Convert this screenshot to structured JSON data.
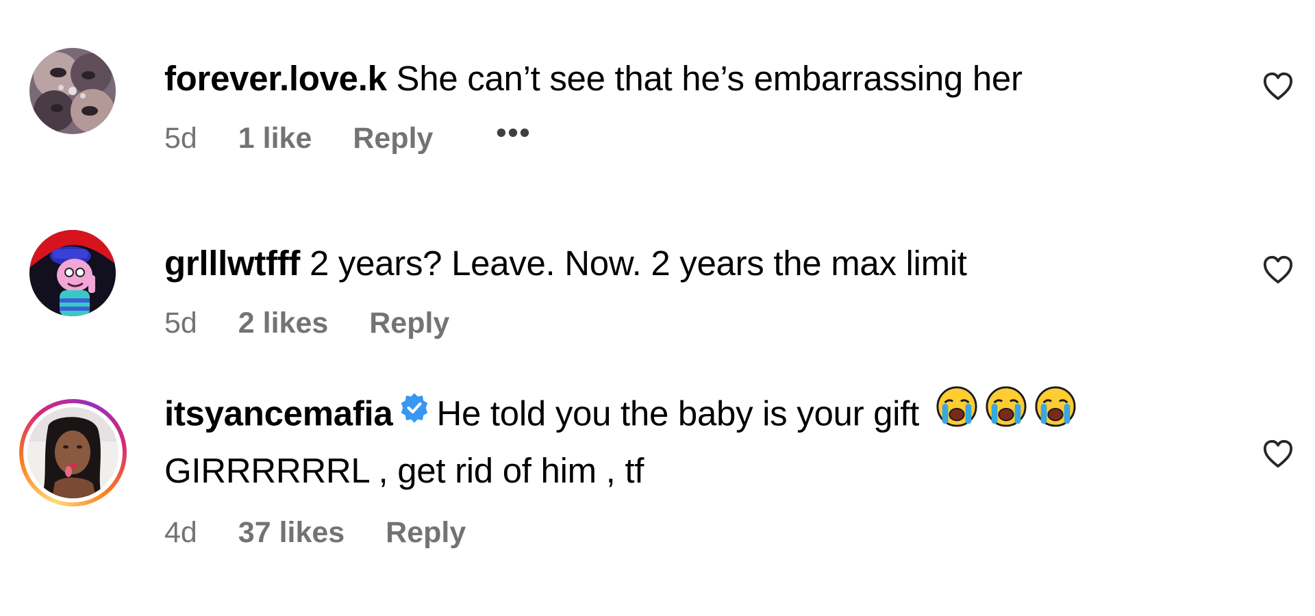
{
  "comments": [
    {
      "username": "forever.love.k",
      "text": "She can’t see that he’s embarrassing her",
      "time": "5d",
      "likes": "1 like",
      "reply_label": "Reply",
      "more_label": "•••",
      "avatar_icon": "avatar-photo"
    },
    {
      "username": "grlllwtfff",
      "text": "2 years? Leave. Now. 2 years the max limit",
      "time": "5d",
      "likes": "2 likes",
      "reply_label": "Reply",
      "avatar_icon": "avatar-cartoon"
    },
    {
      "username": "itsyancemafia",
      "verified": true,
      "text": "He told you the baby is your gift",
      "emoji": "loudly-crying-face",
      "text_line2": "GIRRRRRRL , get rid of him , tf",
      "time": "4d",
      "likes": "37 likes",
      "reply_label": "Reply",
      "avatar_icon": "avatar-photo-with-story-ring"
    }
  ],
  "icons": {
    "like": "heart-outline-icon",
    "verified": "verified-badge-icon"
  },
  "colors": {
    "text": "#000000",
    "secondary": "#737373",
    "verified": "#0095f6",
    "story_ring": [
      "#feda75",
      "#fa7e1e",
      "#d62976",
      "#962fbf"
    ]
  }
}
